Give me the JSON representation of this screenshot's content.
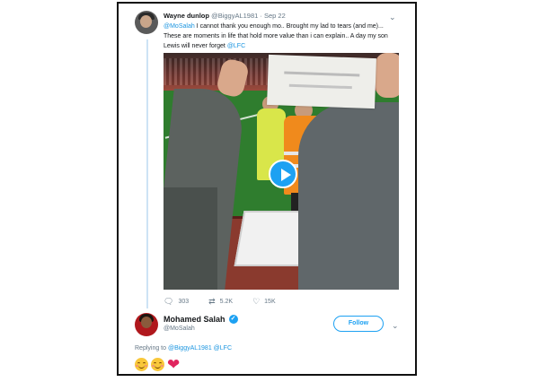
{
  "tweet": {
    "author_name": "Wayne dunlop",
    "author_handle": "@BiggyAL1981",
    "separator": "·",
    "date": "Sep 22",
    "body": {
      "mention": "@MoSalah",
      "line1_rest": " I cannot thank you enough mo.. Brought my lad to tears (and me)...",
      "line2": "These are moments in life that hold more value than i can explain.. A day my son",
      "line3_prefix": "Lewis will never forget ",
      "line3_mention": "@LFC"
    },
    "media": {
      "type": "video",
      "play_icon": "play-icon"
    },
    "actions": {
      "replies": "303",
      "retweets": "5.2K",
      "likes": "15K"
    }
  },
  "reply": {
    "author_name": "Mohamed Salah",
    "author_handle": "@MoSalah",
    "verified_icon": "verified-badge-icon",
    "follow_label": "Follow",
    "replying_prefix": "Replying to ",
    "replying_to_1": "@BiggyAL1981",
    "replying_join": " @LFC",
    "emojis": [
      "smiling-face-emoji",
      "smiling-face-emoji",
      "red-heart-emoji"
    ]
  },
  "colors": {
    "accent": "#1da1f2",
    "text": "#14171a",
    "muted": "#657786",
    "heart": "#e0245e"
  }
}
